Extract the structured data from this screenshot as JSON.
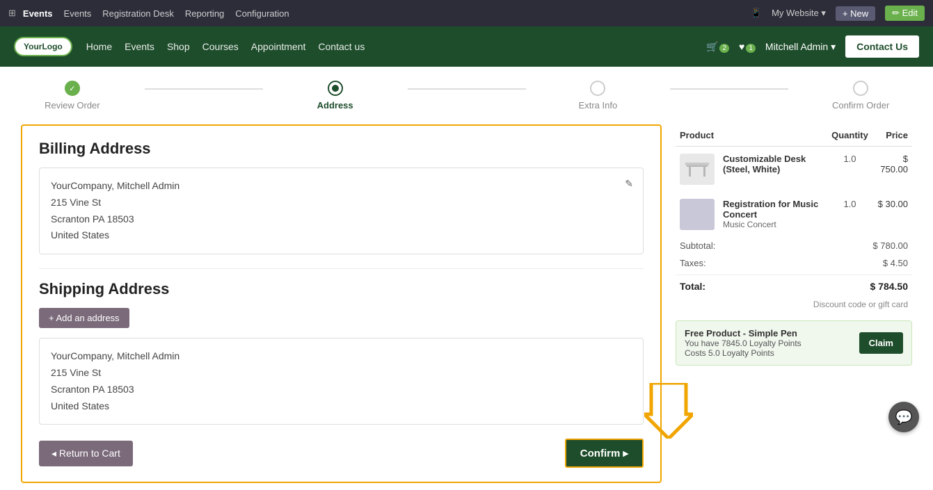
{
  "adminBar": {
    "appIcon": "⊞",
    "moduleName": "Events",
    "navItems": [
      "Events",
      "Registration Desk",
      "Reporting",
      "Configuration"
    ],
    "mobileIcon": "📱",
    "myWebsite": "My Website ▾",
    "newLabel": "+ New",
    "editLabel": "✏ Edit"
  },
  "websiteNav": {
    "logoText": "YourLogo",
    "links": [
      "Home",
      "Events",
      "Shop",
      "Courses",
      "Appointment",
      "Contact us"
    ],
    "cartCount": "2",
    "wishlistCount": "1",
    "userLabel": "Mitchell Admin ▾",
    "contactUsLabel": "Contact Us"
  },
  "steps": [
    {
      "label": "Review Order",
      "state": "done"
    },
    {
      "label": "Address",
      "state": "active"
    },
    {
      "label": "Extra Info",
      "state": "inactive"
    },
    {
      "label": "Confirm Order",
      "state": "inactive"
    }
  ],
  "billingAddress": {
    "title": "Billing Address",
    "line1": "YourCompany, Mitchell Admin",
    "line2": "215 Vine St",
    "line3": "Scranton PA 18503",
    "line4": "United States"
  },
  "shippingAddress": {
    "title": "Shipping Address",
    "addBtn": "+ Add an address",
    "line1": "YourCompany, Mitchell Admin",
    "line2": "215 Vine St",
    "line3": "Scranton PA 18503",
    "line4": "United States"
  },
  "actions": {
    "returnLabel": "◂ Return to Cart",
    "confirmLabel": "Confirm ▸"
  },
  "orderSummary": {
    "columns": [
      "Product",
      "Quantity",
      "Price"
    ],
    "items": [
      {
        "name": "Customizable Desk (Steel, White)",
        "sub": "",
        "qty": "1.0",
        "price": "$ 750.00"
      },
      {
        "name": "Registration for Music Concert",
        "sub": "Music Concert",
        "qty": "1.0",
        "price": "$ 30.00"
      }
    ],
    "subtotalLabel": "Subtotal:",
    "subtotalValue": "$ 780.00",
    "taxesLabel": "Taxes:",
    "taxesValue": "$ 4.50",
    "totalLabel": "Total:",
    "totalValue": "$ 784.50",
    "discountLabel": "Discount code or gift card"
  },
  "freeProduct": {
    "title": "Free Product - Simple Pen",
    "desc1": "You have 7845.0 Loyalty Points",
    "desc2": "Costs 5.0 Loyalty Points",
    "claimLabel": "Claim"
  },
  "chatIcon": "💬"
}
